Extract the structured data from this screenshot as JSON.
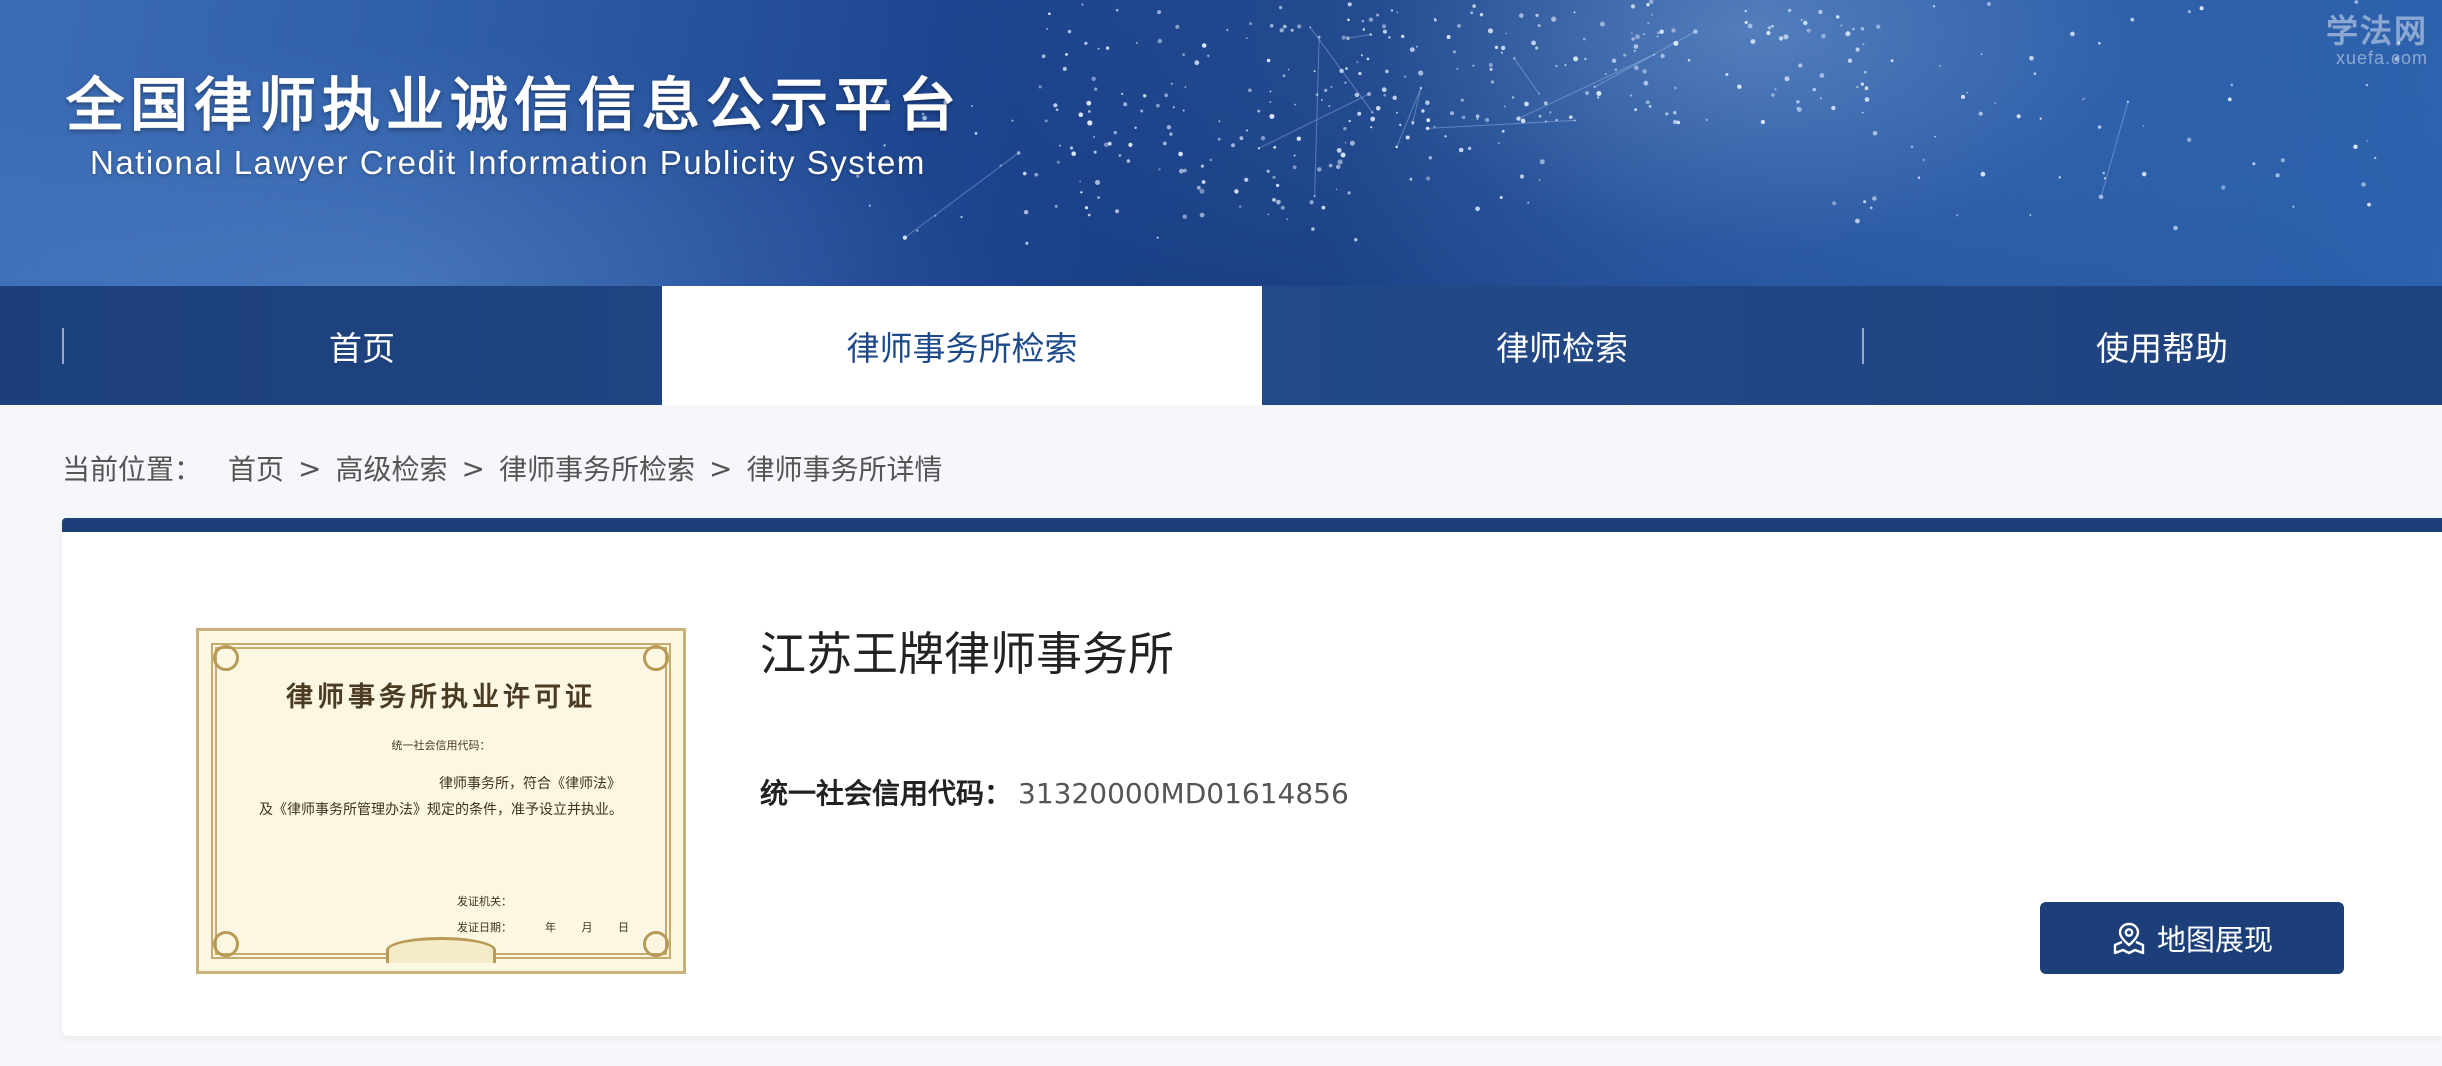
{
  "header": {
    "title": "全国律师执业诚信信息公示平台",
    "subtitle": "National Lawyer Credit Information Publicity System",
    "watermark_main": "学法网",
    "watermark_sub": "xuefa.com"
  },
  "nav": {
    "items": [
      {
        "label": "首页",
        "active": false
      },
      {
        "label": "律师事务所检索",
        "active": true
      },
      {
        "label": "律师检索",
        "active": false
      },
      {
        "label": "使用帮助",
        "active": false
      }
    ]
  },
  "breadcrumb": {
    "label": "当前位置：",
    "items": [
      "首页",
      "高级检索",
      "律师事务所检索",
      "律师事务所详情"
    ],
    "separator": ">"
  },
  "firm": {
    "name": "江苏王牌律师事务所",
    "credit_code_label": "统一社会信用代码：",
    "credit_code": "31320000MD01614856",
    "map_button_label": "地图展现",
    "map_icon": "map-pin-icon"
  },
  "license": {
    "title": "律师事务所执业许可证",
    "code_line": "统一社会信用代码：",
    "body": "律师事务所，符合《律师法》及《律师事务所管理办法》规定的条件，准予设立并执业。",
    "issuer_label": "发证机关：",
    "date_label": "发证日期：",
    "ymd": "年 月 日"
  },
  "colors": {
    "primary": "#1c3f7a",
    "page_bg": "#f5f7fb"
  }
}
